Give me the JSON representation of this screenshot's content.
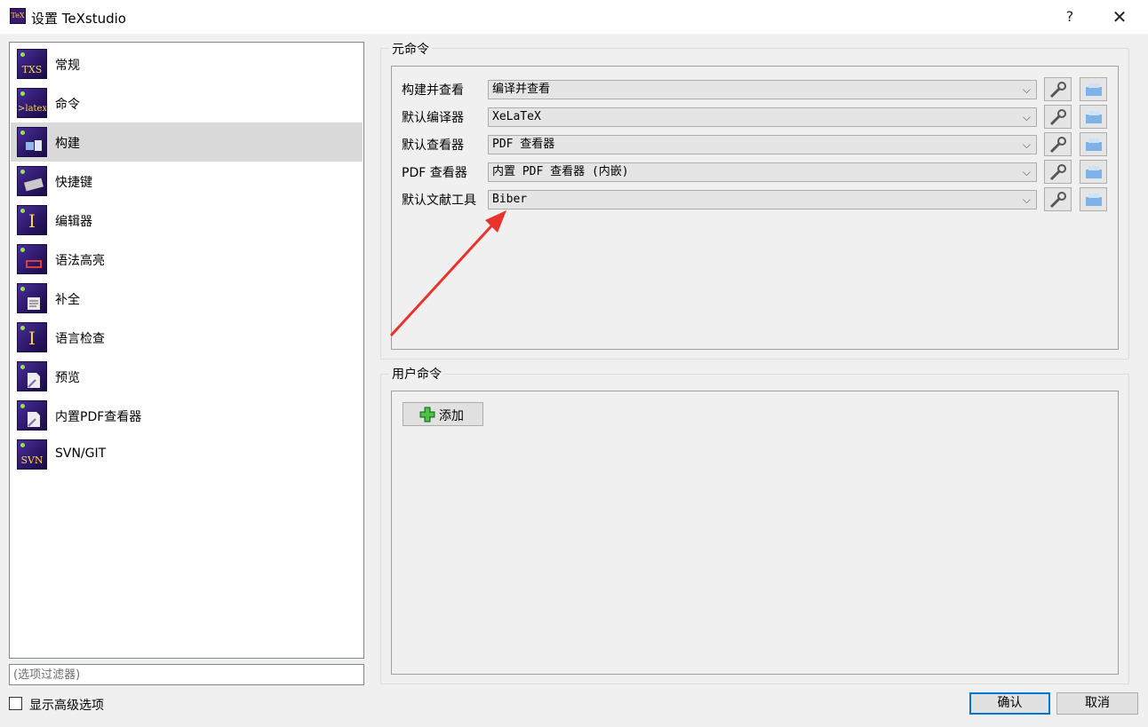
{
  "window": {
    "title": "设置 TeXstudio",
    "help_label": "?",
    "close_label": "✕"
  },
  "nav": {
    "items": [
      {
        "label": "常规",
        "icon": "txs-icon",
        "icon_text": "TXS"
      },
      {
        "label": "命令",
        "icon": "latex-icon",
        "icon_text": ">latex"
      },
      {
        "label": "构建",
        "icon": "build-icon",
        "icon_text": ""
      },
      {
        "label": "快捷键",
        "icon": "keyboard-icon",
        "icon_text": ""
      },
      {
        "label": "编辑器",
        "icon": "editor-cursor-icon",
        "icon_text": "I"
      },
      {
        "label": "语法高亮",
        "icon": "syntax-highlight-icon",
        "icon_text": ""
      },
      {
        "label": "补全",
        "icon": "completion-icon",
        "icon_text": ""
      },
      {
        "label": "语言检查",
        "icon": "language-check-icon",
        "icon_text": "I"
      },
      {
        "label": "预览",
        "icon": "preview-icon",
        "icon_text": ""
      },
      {
        "label": "内置PDF查看器",
        "icon": "pdf-viewer-icon",
        "icon_text": ""
      },
      {
        "label": "SVN/GIT",
        "icon": "svn-icon",
        "icon_text": "SVN"
      }
    ],
    "selected": "构建",
    "filter_placeholder": "(选项过滤器)",
    "show_advanced_label": "显示高级选项",
    "show_advanced_checked": false
  },
  "meta_commands": {
    "title": "元命令",
    "rows": [
      {
        "label": "构建并查看",
        "value": "编译并查看"
      },
      {
        "label": "默认编译器",
        "value": "XeLaTeX"
      },
      {
        "label": "默认查看器",
        "value": "PDF 查看器"
      },
      {
        "label": "PDF 查看器",
        "value": "内置 PDF 查看器 (内嵌)"
      },
      {
        "label": "默认文献工具",
        "value": "Biber"
      }
    ]
  },
  "user_commands": {
    "title": "用户命令",
    "add_label": "添加"
  },
  "footer": {
    "ok_label": "确认",
    "cancel_label": "取消"
  },
  "colors": {
    "annotation_arrow": "#e8322b",
    "focus_border": "#0078d7",
    "selected_nav_bg": "#d9d9d9"
  }
}
